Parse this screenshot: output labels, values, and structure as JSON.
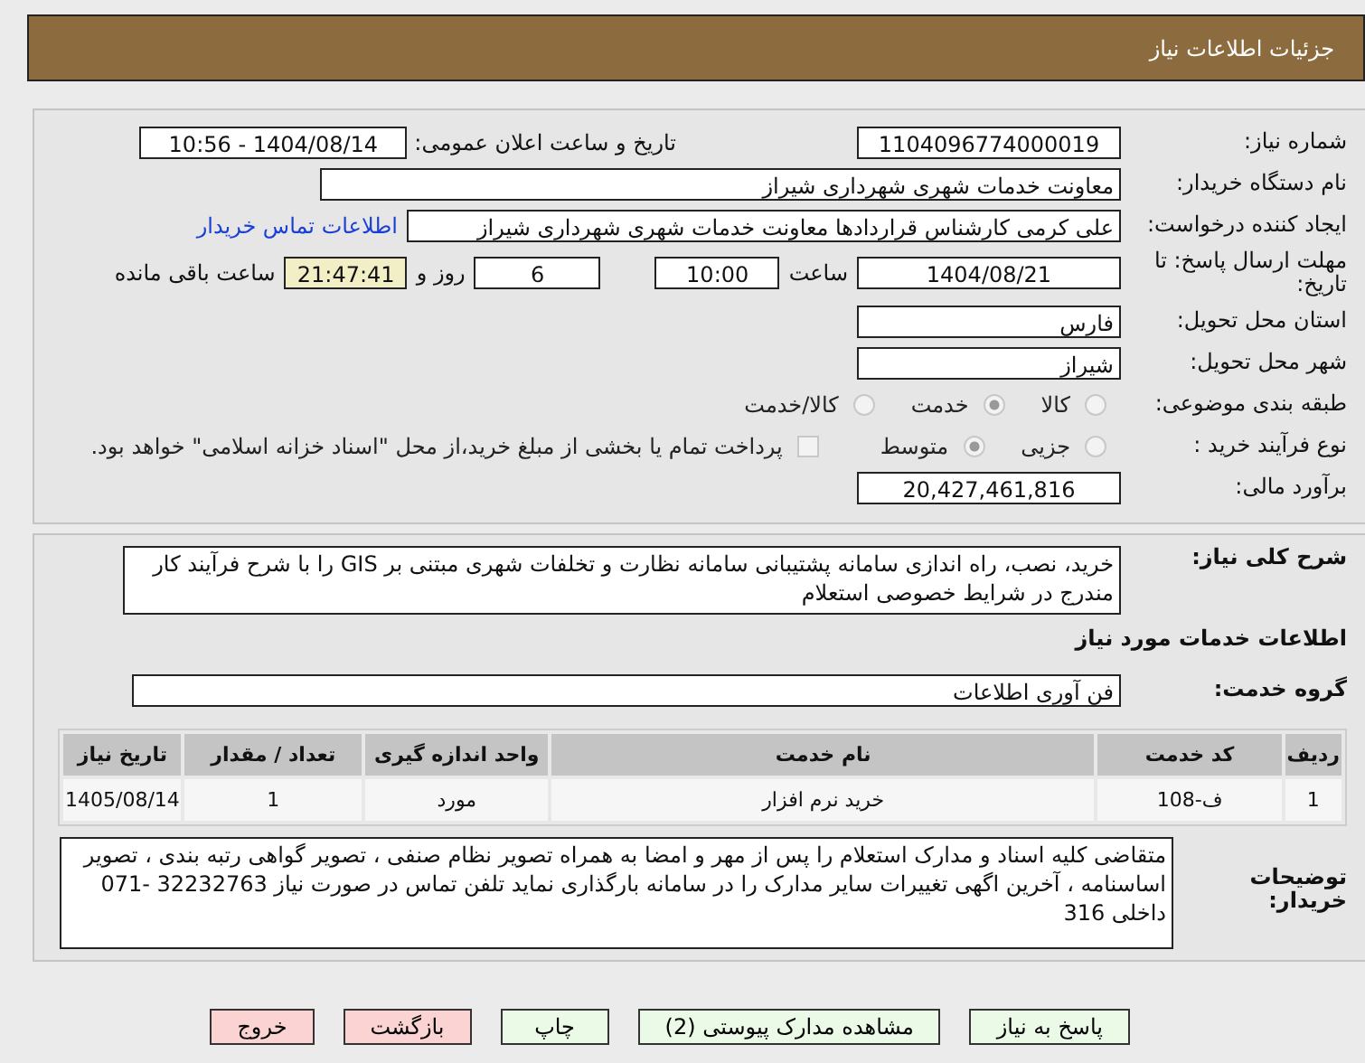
{
  "title": "جزئیات اطلاعات نیاز",
  "need_number": {
    "label": "شماره نیاز:",
    "value": "1104096774000019"
  },
  "announce": {
    "label": "تاریخ و ساعت اعلان عمومی:",
    "value": "1404/08/14 - 10:56"
  },
  "buyer_org": {
    "label": "نام دستگاه خریدار:",
    "value": "معاونت خدمات شهری شهرداری شیراز"
  },
  "creator": {
    "label": "ایجاد کننده درخواست:",
    "value": "علی کرمی کارشناس قراردادها معاونت خدمات شهری شهرداری شیراز",
    "link": "اطلاعات تماس خریدار"
  },
  "deadline": {
    "label": "مهلت ارسال پاسخ: تا تاریخ:",
    "date": "1404/08/21",
    "time_label": "ساعت",
    "time": "10:00",
    "days": "6",
    "days_label": "روز و",
    "remaining": "21:47:41",
    "remaining_label": "ساعت باقی مانده"
  },
  "province": {
    "label": "استان محل تحویل:",
    "value": "فارس"
  },
  "city": {
    "label": "شهر محل تحویل:",
    "value": "شیراز"
  },
  "category": {
    "label": "طبقه بندی موضوعی:",
    "options": [
      {
        "label": "کالا",
        "selected": false
      },
      {
        "label": "خدمت",
        "selected": true
      },
      {
        "label": "کالا/خدمت",
        "selected": false
      }
    ]
  },
  "process": {
    "label": "نوع فرآیند خرید :",
    "options": [
      {
        "label": "جزیی",
        "selected": false
      },
      {
        "label": "متوسط",
        "selected": true
      }
    ],
    "payment": {
      "label": "پرداخت تمام یا بخشی از مبلغ خرید،از محل \"اسناد خزانه اسلامی\" خواهد بود.",
      "checked": false
    }
  },
  "budget": {
    "label": "برآورد مالی:",
    "value": "20,427,461,816"
  },
  "description": {
    "label": "شرح کلی نیاز:",
    "value": "خرید، نصب، راه اندازی سامانه پشتیبانی سامانه نظارت و تخلفات شهری مبتنی بر GIS را با شرح فرآیند کار مندرج در شرایط خصوصی استعلام"
  },
  "services_heading": "اطلاعات خدمات مورد نیاز",
  "service_group": {
    "label": "گروه خدمت:",
    "value": "فن آوری اطلاعات"
  },
  "table": {
    "columns": [
      "ردیف",
      "کد خدمت",
      "نام خدمت",
      "واحد اندازه گیری",
      "تعداد / مقدار",
      "تاریخ نیاز"
    ],
    "rows": [
      [
        "1",
        "ف-108",
        "خرید نرم افزار",
        "مورد",
        "1",
        "1405/08/14"
      ]
    ]
  },
  "buyer_notes": {
    "label": "توضیحات خریدار:",
    "value": "متقاضی کلیه اسناد و مدارک استعلام را پس از مهر و امضا به همراه تصویر  نظام صنفی  ، تصویر گواهی رتبه بندی ، تصویر اساسنامه ، آخرین اگهی تغییرات سایر مدارک را در سامانه بارگذاری نماید تلفن تماس در صورت نیاز 32232763 -071 داخلی 316"
  },
  "buttons": [
    {
      "label": "پاسخ به نیاز",
      "kind": "primary"
    },
    {
      "label": "مشاهده مدارک پیوستی (2)",
      "kind": "primary"
    },
    {
      "label": "چاپ",
      "kind": "primary"
    },
    {
      "label": "بازگشت",
      "kind": "danger"
    },
    {
      "label": "خروج",
      "kind": "danger"
    }
  ]
}
